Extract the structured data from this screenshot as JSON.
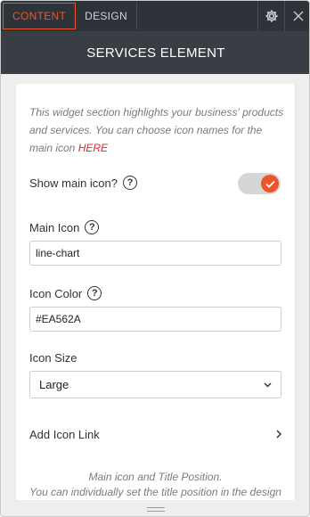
{
  "tabs": [
    {
      "label": "CONTENT",
      "active": true
    },
    {
      "label": "DESIGN",
      "active": false
    }
  ],
  "header": {
    "title": "SERVICES ELEMENT"
  },
  "intro": {
    "text": "This widget section highlights your business' products and services. You can choose icon names for the main icon ",
    "link_text": "HERE"
  },
  "show_main_icon": {
    "label": "Show main icon?",
    "enabled": true
  },
  "main_icon": {
    "label": "Main Icon",
    "value": "line-chart"
  },
  "icon_color": {
    "label": "Icon Color",
    "value": "#EA562A"
  },
  "icon_size": {
    "label": "Icon Size",
    "selected": "Large"
  },
  "add_icon_link": {
    "label": "Add Icon Link"
  },
  "footer_note": {
    "line1": "Main icon and Title Position.",
    "line2": "You can individually set the title position in the design"
  },
  "help_glyph": "?",
  "colors": {
    "accent": "#EA562A",
    "link": "#E8232A",
    "dark": "#2E3339",
    "header": "#393E44"
  },
  "icons": [
    "gear-icon",
    "close-icon",
    "help-icon",
    "check-icon",
    "chevron-down-icon",
    "chevron-right-icon",
    "resize-grip-icon"
  ]
}
